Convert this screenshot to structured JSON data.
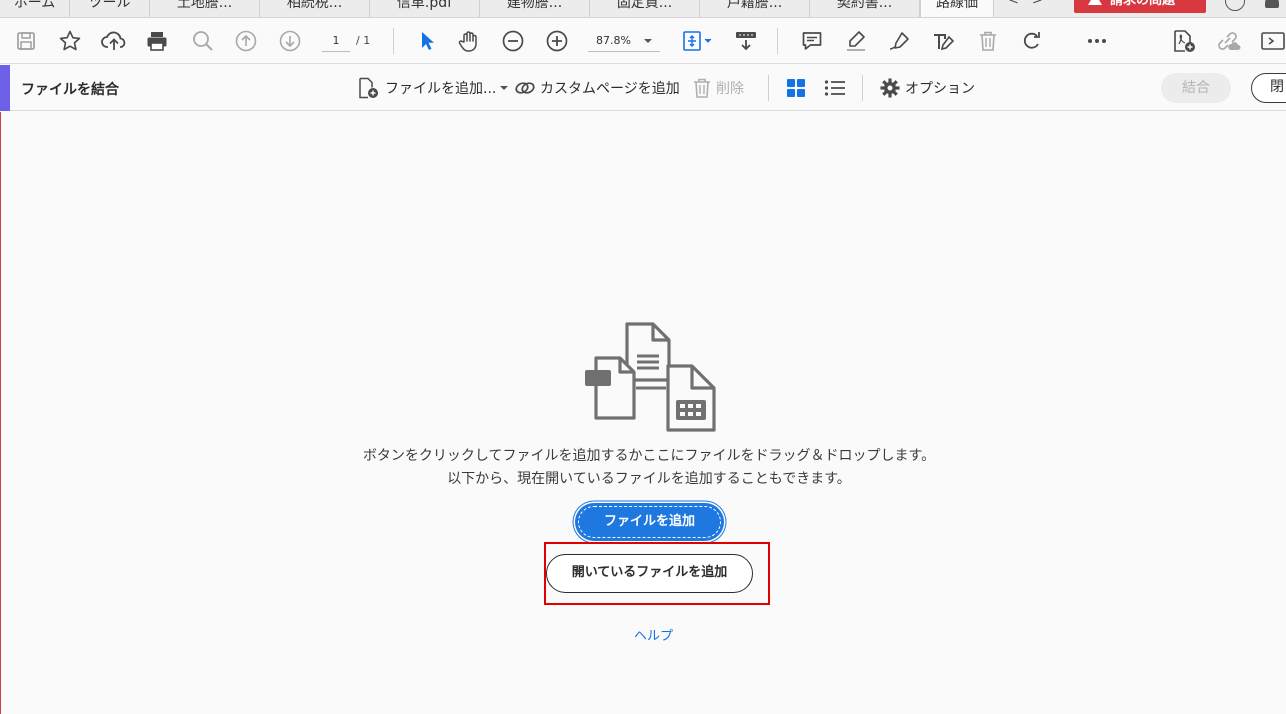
{
  "tabs": [
    {
      "label": "ホーム"
    },
    {
      "label": "ツール"
    },
    {
      "label": "土地謄..."
    },
    {
      "label": "相続税..."
    },
    {
      "label": "信革.pdf"
    },
    {
      "label": "建物謄..."
    },
    {
      "label": "固定資..."
    },
    {
      "label": "戸籍謄..."
    },
    {
      "label": "契約書..."
    },
    {
      "label": "路線価"
    }
  ],
  "tab_nav": {
    "prev": "<",
    "next": ">"
  },
  "warning_button": {
    "label": "請求の問題"
  },
  "toolbar": {
    "page_current": "1",
    "page_total": "/ 1",
    "zoom": "87.8%"
  },
  "combine_toolbar": {
    "title": "ファイルを結合",
    "add_files": "ファイルを追加...",
    "add_custom_page": "カスタムページを追加",
    "delete": "削除",
    "options": "オプション",
    "combine": "結合",
    "close": "閉"
  },
  "content": {
    "message_line1": "ボタンをクリックしてファイルを追加するかここにファイルをドラッグ＆ドロップします。",
    "message_line2": "以下から、現在開いているファイルを追加することもできます。",
    "add_files_button": "ファイルを追加",
    "add_open_files_button": "開いているファイルを追加",
    "help_link": "ヘルプ"
  },
  "colors": {
    "primary_blue": "#1f78e0",
    "warning_red": "#d7373f",
    "accent_purple": "#6d5fe6",
    "highlight_red": "#e00000"
  }
}
